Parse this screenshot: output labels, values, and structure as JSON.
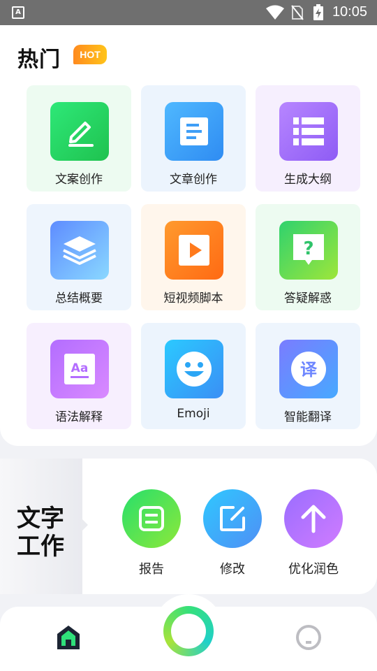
{
  "status_bar": {
    "time": "10:05",
    "app_letter": "A"
  },
  "hot": {
    "title": "热门",
    "badge": "HOT",
    "tiles": [
      {
        "label": "文案创作",
        "icon": "pencil-icon",
        "tile_bg": "#edfbf1",
        "icon_bg": [
          "#2ee878",
          "#1fc24f"
        ]
      },
      {
        "label": "文章创作",
        "icon": "document-icon",
        "tile_bg": "#ecf4fd",
        "icon_bg": [
          "#4fb8ff",
          "#2f8cf2"
        ]
      },
      {
        "label": "生成大纲",
        "icon": "list-icon",
        "tile_bg": "#f6effe",
        "icon_bg": [
          "#b786ff",
          "#8e5cf5"
        ]
      },
      {
        "label": "总结概要",
        "icon": "layers-icon",
        "tile_bg": "#eef5fd",
        "icon_bg": [
          "#5e8cff",
          "#8ad8ff"
        ]
      },
      {
        "label": "短视频脚本",
        "icon": "play-icon",
        "tile_bg": "#fff6ec",
        "icon_bg": [
          "#ff9a2e",
          "#ff6a13"
        ]
      },
      {
        "label": "答疑解惑",
        "icon": "question-bubble-icon",
        "tile_bg": "#edfbf1",
        "icon_bg": [
          "#2fd26e",
          "#9ee63a"
        ]
      },
      {
        "label": "语法解释",
        "icon": "grammar-icon",
        "tile_bg": "#f7effe",
        "icon_bg": [
          "#b36dff",
          "#d98aff"
        ]
      },
      {
        "label": "Emoji",
        "icon": "emoji-icon",
        "tile_bg": "#ecf4fd",
        "icon_bg": [
          "#2bc9ff",
          "#3a8ff5"
        ]
      },
      {
        "label": "智能翻译",
        "icon": "translate-icon",
        "tile_bg": "#eef5fd",
        "icon_bg": [
          "#7a7cff",
          "#47a9ff"
        ]
      }
    ],
    "translate_glyph": "译",
    "grammar_glyph": "Aa",
    "question_glyph": "?"
  },
  "work": {
    "title": "文字工作",
    "buttons": [
      {
        "label": "报告",
        "icon": "report-icon"
      },
      {
        "label": "修改",
        "icon": "edit-icon"
      },
      {
        "label": "优化润色",
        "icon": "arrow-up-icon"
      }
    ]
  },
  "nav": {
    "items": [
      "home-icon",
      "create-ring-icon",
      "profile-icon"
    ]
  }
}
